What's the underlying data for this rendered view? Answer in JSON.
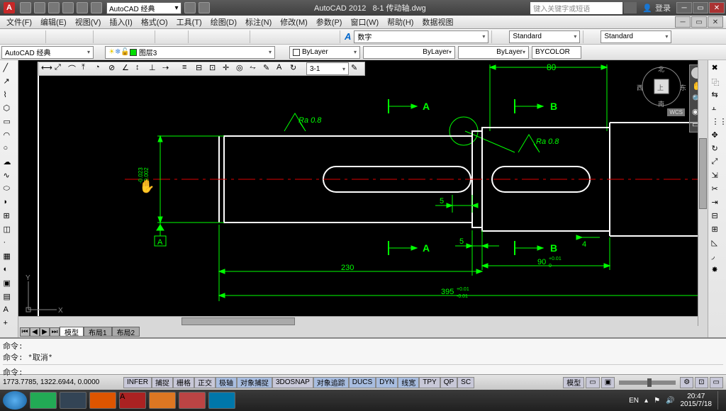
{
  "titlebar": {
    "workspace": "AutoCAD 经典",
    "app": "AutoCAD 2012",
    "doc": "8-1 传动轴.dwg",
    "search_placeholder": "键入关键字或短语",
    "login": "登录"
  },
  "menu": [
    "文件(F)",
    "编辑(E)",
    "视图(V)",
    "插入(I)",
    "格式(O)",
    "工具(T)",
    "绘图(D)",
    "标注(N)",
    "修改(M)",
    "参数(P)",
    "窗口(W)",
    "帮助(H)",
    "数据视图"
  ],
  "layerrow": {
    "workspace": "AutoCAD 经典",
    "layer": "图层3",
    "color_sel": "ByLayer",
    "lt_sel": "ByLayer",
    "lw_sel": "ByLayer",
    "bycolor": "BYCOLOR"
  },
  "props": {
    "scale": "数字",
    "style1": "Standard",
    "style2": "Standard"
  },
  "topdd": "3-1",
  "viewcube": {
    "n": "北",
    "s": "南",
    "e": "东",
    "w": "西",
    "top": "上",
    "wcs": "WCS"
  },
  "drawing": {
    "dim_230": "230",
    "dim_395": "395",
    "dim_80": "80",
    "dim_5a": "5",
    "dim_5b": "5",
    "dim_4": "4",
    "dim_90": "90",
    "dim_90_tp": "+0.01",
    "dim_90_tm": "0",
    "dim_395_tp": "+0.01",
    "dim_395_tm": "-0.01",
    "label_A1": "A",
    "label_A2": "A",
    "label_B1": "B",
    "label_B2": "B",
    "datum_A": "A",
    "ra1": "Ra  0.8",
    "ra2": "Ra  0.8",
    "vdim_t1": "-0.023",
    "vdim_t2": "-0.002"
  },
  "tabs": {
    "model": "模型",
    "layout1": "布局1",
    "layout2": "布局2"
  },
  "cmd": {
    "l1": "命令:",
    "l2": "命令: *取消*",
    "l3": "命令:"
  },
  "status": {
    "coords": "1773.7785, 1322.6944, 0.0000",
    "toggles": [
      "INFER",
      "捕捉",
      "栅格",
      "正交",
      "极轴",
      "对象捕捉",
      "3DOSNAP",
      "对象追踪",
      "DUCS",
      "DYN",
      "线宽",
      "TPY",
      "QP",
      "SC"
    ],
    "on": [
      4,
      5,
      7,
      8,
      9,
      10
    ],
    "modeltab": "模型"
  },
  "taskbar": {
    "time": "20:47",
    "date": "2015/7/18",
    "lang": "EN"
  }
}
